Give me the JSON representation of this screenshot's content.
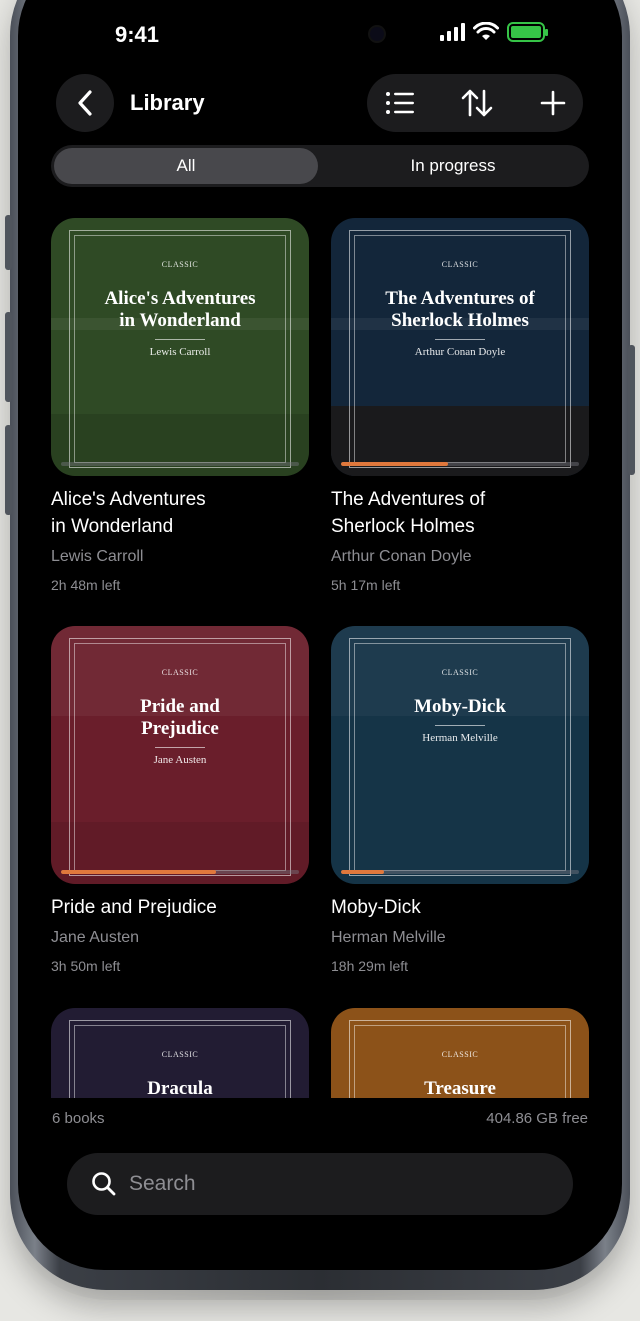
{
  "status_bar": {
    "time": "9:41"
  },
  "header": {
    "title": "Library"
  },
  "tabs": [
    {
      "label": "All",
      "active": true
    },
    {
      "label": "In progress",
      "active": false
    }
  ],
  "books": [
    {
      "cover_tag": "CLASSIC",
      "cover_title_lines": [
        "Alice's Adventures",
        "in Wonderland"
      ],
      "title_lines": [
        "Alice's Adventures",
        "in Wonderland"
      ],
      "author": "Lewis Carroll",
      "time_left": "2h 48m left",
      "progress": 0,
      "color": "#2f4a25"
    },
    {
      "cover_tag": "CLASSIC",
      "cover_title_lines": [
        "The Adventures of",
        "Sherlock Holmes"
      ],
      "title_lines": [
        "The Adventures of",
        "Sherlock Holmes"
      ],
      "author": "Arthur Conan Doyle",
      "time_left": "5h 17m left",
      "progress": 0.45,
      "color": "#13263a"
    },
    {
      "cover_tag": "CLASSIC",
      "cover_title_lines": [
        "Pride and",
        "Prejudice"
      ],
      "title_lines": [
        "Pride and Prejudice"
      ],
      "author": "Jane Austen",
      "time_left": "3h 50m left",
      "progress": 0.65,
      "color": "#6a1e2b"
    },
    {
      "cover_tag": "CLASSIC",
      "cover_title_lines": [
        "Moby-Dick"
      ],
      "title_lines": [
        "Moby-Dick"
      ],
      "author": "Herman Melville",
      "time_left": "18h 29m left",
      "progress": 0.18,
      "color": "#153447"
    },
    {
      "cover_tag": "CLASSIC",
      "cover_title_lines": [
        "Dracula"
      ],
      "title_lines": [],
      "author": "",
      "time_left": "",
      "progress": 0,
      "color": "#221c33"
    },
    {
      "cover_tag": "CLASSIC",
      "cover_title_lines": [
        "Treasure"
      ],
      "title_lines": [],
      "author": "",
      "time_left": "",
      "progress": 0,
      "color": "#8c5219"
    }
  ],
  "footer": {
    "count": "6 books",
    "free_space": "404.86 GB free"
  },
  "search": {
    "placeholder": "Search"
  },
  "colors": {
    "accent": "#e0783c",
    "background": "#000000",
    "surface": "#1c1c1e",
    "secondary_text": "#8e8e93"
  }
}
